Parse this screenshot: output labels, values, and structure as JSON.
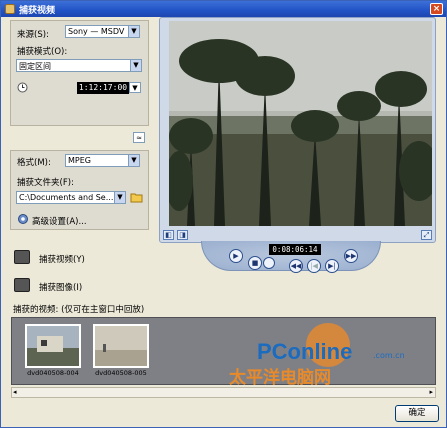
{
  "window": {
    "title": "捕获视频",
    "close_glyph": "×"
  },
  "source": {
    "label": "来源(S):",
    "value": "Sony — MSDV",
    "mode_label": "捕获模式(O):",
    "mode_value": "固定区间",
    "timecode": "1:12:17:00"
  },
  "collapse_glyph": "≈",
  "format": {
    "label": "格式(M):",
    "value": "MPEG",
    "folder_label": "捕获文件夹(F):",
    "folder_value": "C:\\Documents and Se...",
    "advanced_label": "高级设置(A)..."
  },
  "player": {
    "timecode": "0:08:06:14"
  },
  "capture": {
    "video_label": "捕获视频(Y)",
    "image_label": "捕获图像(I)",
    "captured_label": "捕获的视频: (仅可在主窗口中回放)"
  },
  "thumbnails": [
    {
      "name": "dvd040508-004"
    },
    {
      "name": "dvd040508-005"
    }
  ],
  "watermark": {
    "brand": "PConline",
    "domain": ".com.cn",
    "cn_name": "太平洋电脑网"
  },
  "ok_label": "确定",
  "colors": {
    "title_bar": "#2253c6",
    "watermark_orange": "#e88a2a",
    "watermark_blue": "#1b6bbf"
  }
}
